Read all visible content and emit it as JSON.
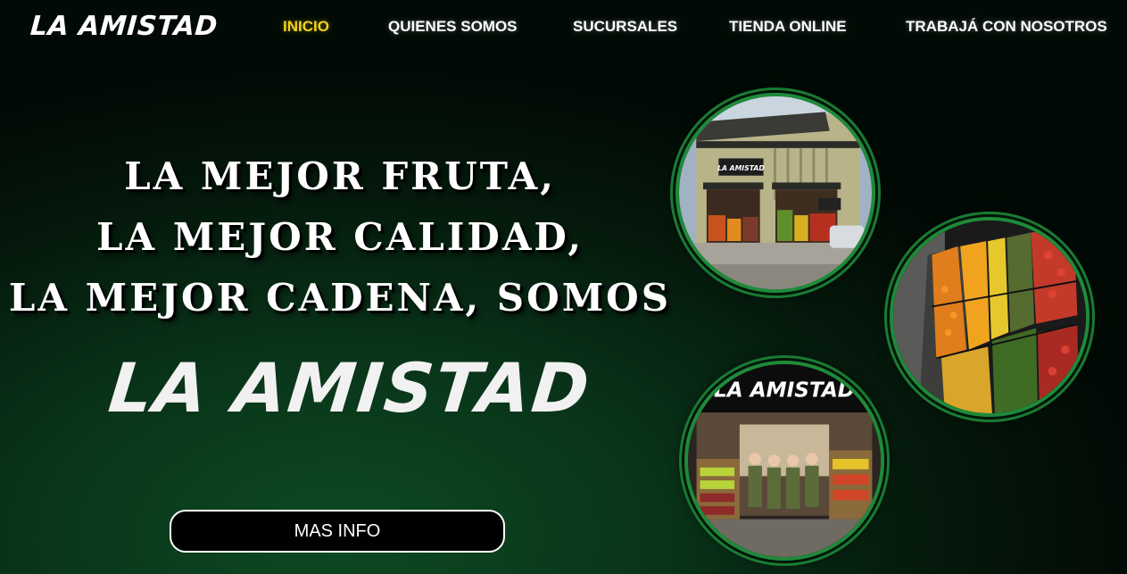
{
  "header": {
    "logo": "LA AMISTAD",
    "nav": [
      {
        "label": "INICIO",
        "active": true
      },
      {
        "label": "QUIENES SOMOS",
        "active": false
      },
      {
        "label": "SUCURSALES",
        "active": false
      },
      {
        "label": "TIENDA ONLINE",
        "active": false
      },
      {
        "label": "TRABAJÁ CON NOSOTROS",
        "active": false
      }
    ]
  },
  "hero": {
    "lines": [
      "LA MEJOR FRUTA,",
      "LA MEJOR CALIDAD,",
      "LA MEJOR CADENA, SOMOS"
    ],
    "brand": "LA AMISTAD",
    "button_label": "MAS INFO"
  },
  "photos": {
    "store_sign": "LA AMISTAD",
    "staff_sign": "LA AMISTAD"
  },
  "colors": {
    "accent_active": "#f2d21b",
    "ring_green": "#1f8a3a",
    "background_dark": "#020a05"
  }
}
